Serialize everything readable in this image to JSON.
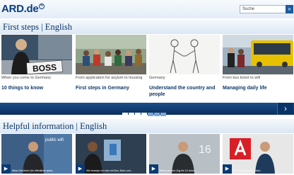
{
  "header": {
    "logo": "ARD.de",
    "logo_mark": "®",
    "search_placeholder": "Suche",
    "search_button": "»"
  },
  "section1": {
    "title": "First steps | English",
    "cards": [
      {
        "kicker": "When you come to Germany",
        "title": "10 things to know",
        "image_text": "BOSS"
      },
      {
        "kicker": "From application for asylum to housing",
        "title": "First steps in Germany"
      },
      {
        "kicker": "Germany",
        "title": "Understand the country and people"
      },
      {
        "kicker": "From bus ticket to wifi",
        "title": "Managing daily life"
      }
    ]
  },
  "carousel": {
    "dots": 7,
    "active_dots": 4,
    "next_icon": "chevron-right-icon",
    "next_glyph": "›"
  },
  "section2": {
    "title": "Helpful information | English",
    "videos": [
      {
        "overlay": "public wifi",
        "caption": "Wlan-Gebühren (für öffentliche wlan)..."
      },
      {
        "overlay": "",
        "caption": "Wie bewege ich mich mit Bus, Bahn und..."
      },
      {
        "overlay": "16",
        "caption": "Reise mit dem Zug bis 16 Jahre..."
      },
      {
        "overlay": "",
        "caption": "Wie finde ich eine Arbeit..."
      }
    ],
    "play_glyph": "▶"
  },
  "colors": {
    "brand_blue": "#0a3d7d",
    "title_blue": "#0d3868",
    "nav_blue": "#0b2f5c"
  }
}
